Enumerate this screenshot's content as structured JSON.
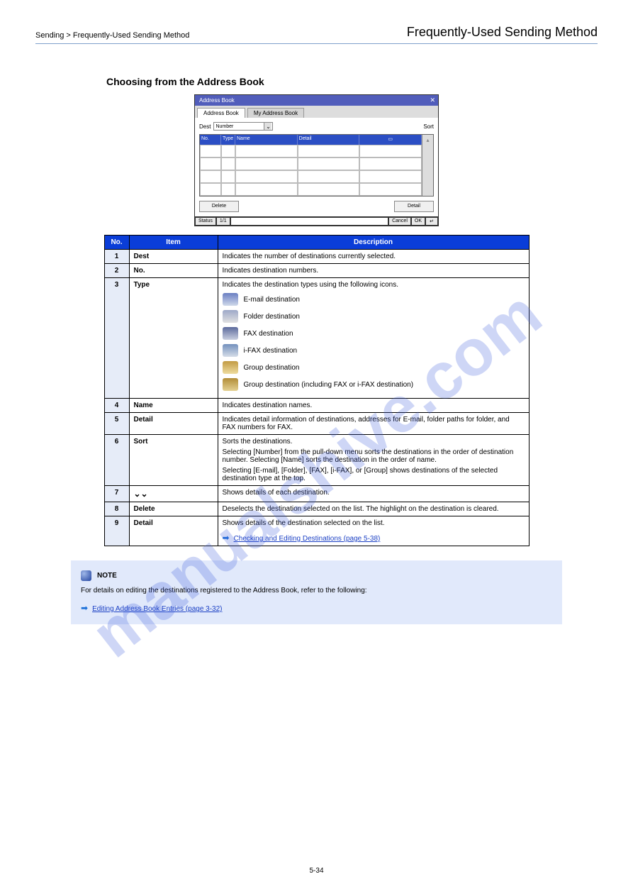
{
  "header": {
    "left": "Sending > Frequently-Used Sending Method",
    "right": "Frequently-Used Sending Method"
  },
  "section_title": "Choosing from the Address Book",
  "shot": {
    "title": "Address Book",
    "tab_active": "Address Book",
    "tab_inactive": "My Address Book",
    "dest_label": "Dest",
    "sort_label": "Sort",
    "sort_value": "Number",
    "headers": [
      "No.",
      "Type",
      "Name",
      "Detail",
      ""
    ],
    "buttons": {
      "delete": "Delete",
      "detail": "Detail"
    },
    "status": [
      "Status",
      "1/1",
      "",
      "Cancel",
      "OK"
    ]
  },
  "table": {
    "head": [
      "No.",
      "Item",
      "Description"
    ],
    "rows": [
      {
        "no": "1",
        "item": "Dest",
        "desc": "Indicates the number of destinations currently selected."
      },
      {
        "no": "2",
        "item": "No.",
        "desc": "Indicates destination numbers."
      },
      {
        "no": "3",
        "item": "Type",
        "desc_intro": "Indicates the destination types using the following icons.",
        "icons": [
          "E-mail destination",
          "Folder destination",
          "FAX destination",
          "i-FAX destination",
          "Group destination",
          "Group destination (including FAX or i-FAX destination)"
        ]
      },
      {
        "no": "4",
        "item": "Name",
        "desc": "Indicates destination names."
      },
      {
        "no": "5",
        "item": "Detail",
        "desc": "Indicates detail information of destinations, addresses for E-mail, folder paths for folder, and FAX numbers for FAX."
      },
      {
        "no": "6",
        "item": "Sort",
        "desc_lines": [
          "Sorts the destinations.",
          "Selecting [Number] from the pull-down menu sorts the destinations in the order of destination number. Selecting [Name] sorts the destination in the order of name.",
          "Selecting [E-mail], [Folder], [FAX], [i-FAX], or [Group] shows destinations of the selected destination type at the top."
        ]
      },
      {
        "no": "7",
        "item_icon": true,
        "desc": "Shows details of each destination."
      },
      {
        "no": "8",
        "item": "Delete",
        "desc": "Deselects the destination selected on the list. The highlight on the destination is cleared."
      },
      {
        "no": "9",
        "item": "Detail",
        "desc_intro": "Shows details of the destination selected on the list.",
        "link": "Checking and Editing Destinations (page 5-38)"
      }
    ]
  },
  "info": {
    "title": "NOTE",
    "line1": "For details on editing the destinations registered to the Address Book, refer to the following:",
    "link": "Editing Address Book Entries (page 3-32)"
  },
  "page_number": "5-34",
  "watermark": "manualshive.com"
}
